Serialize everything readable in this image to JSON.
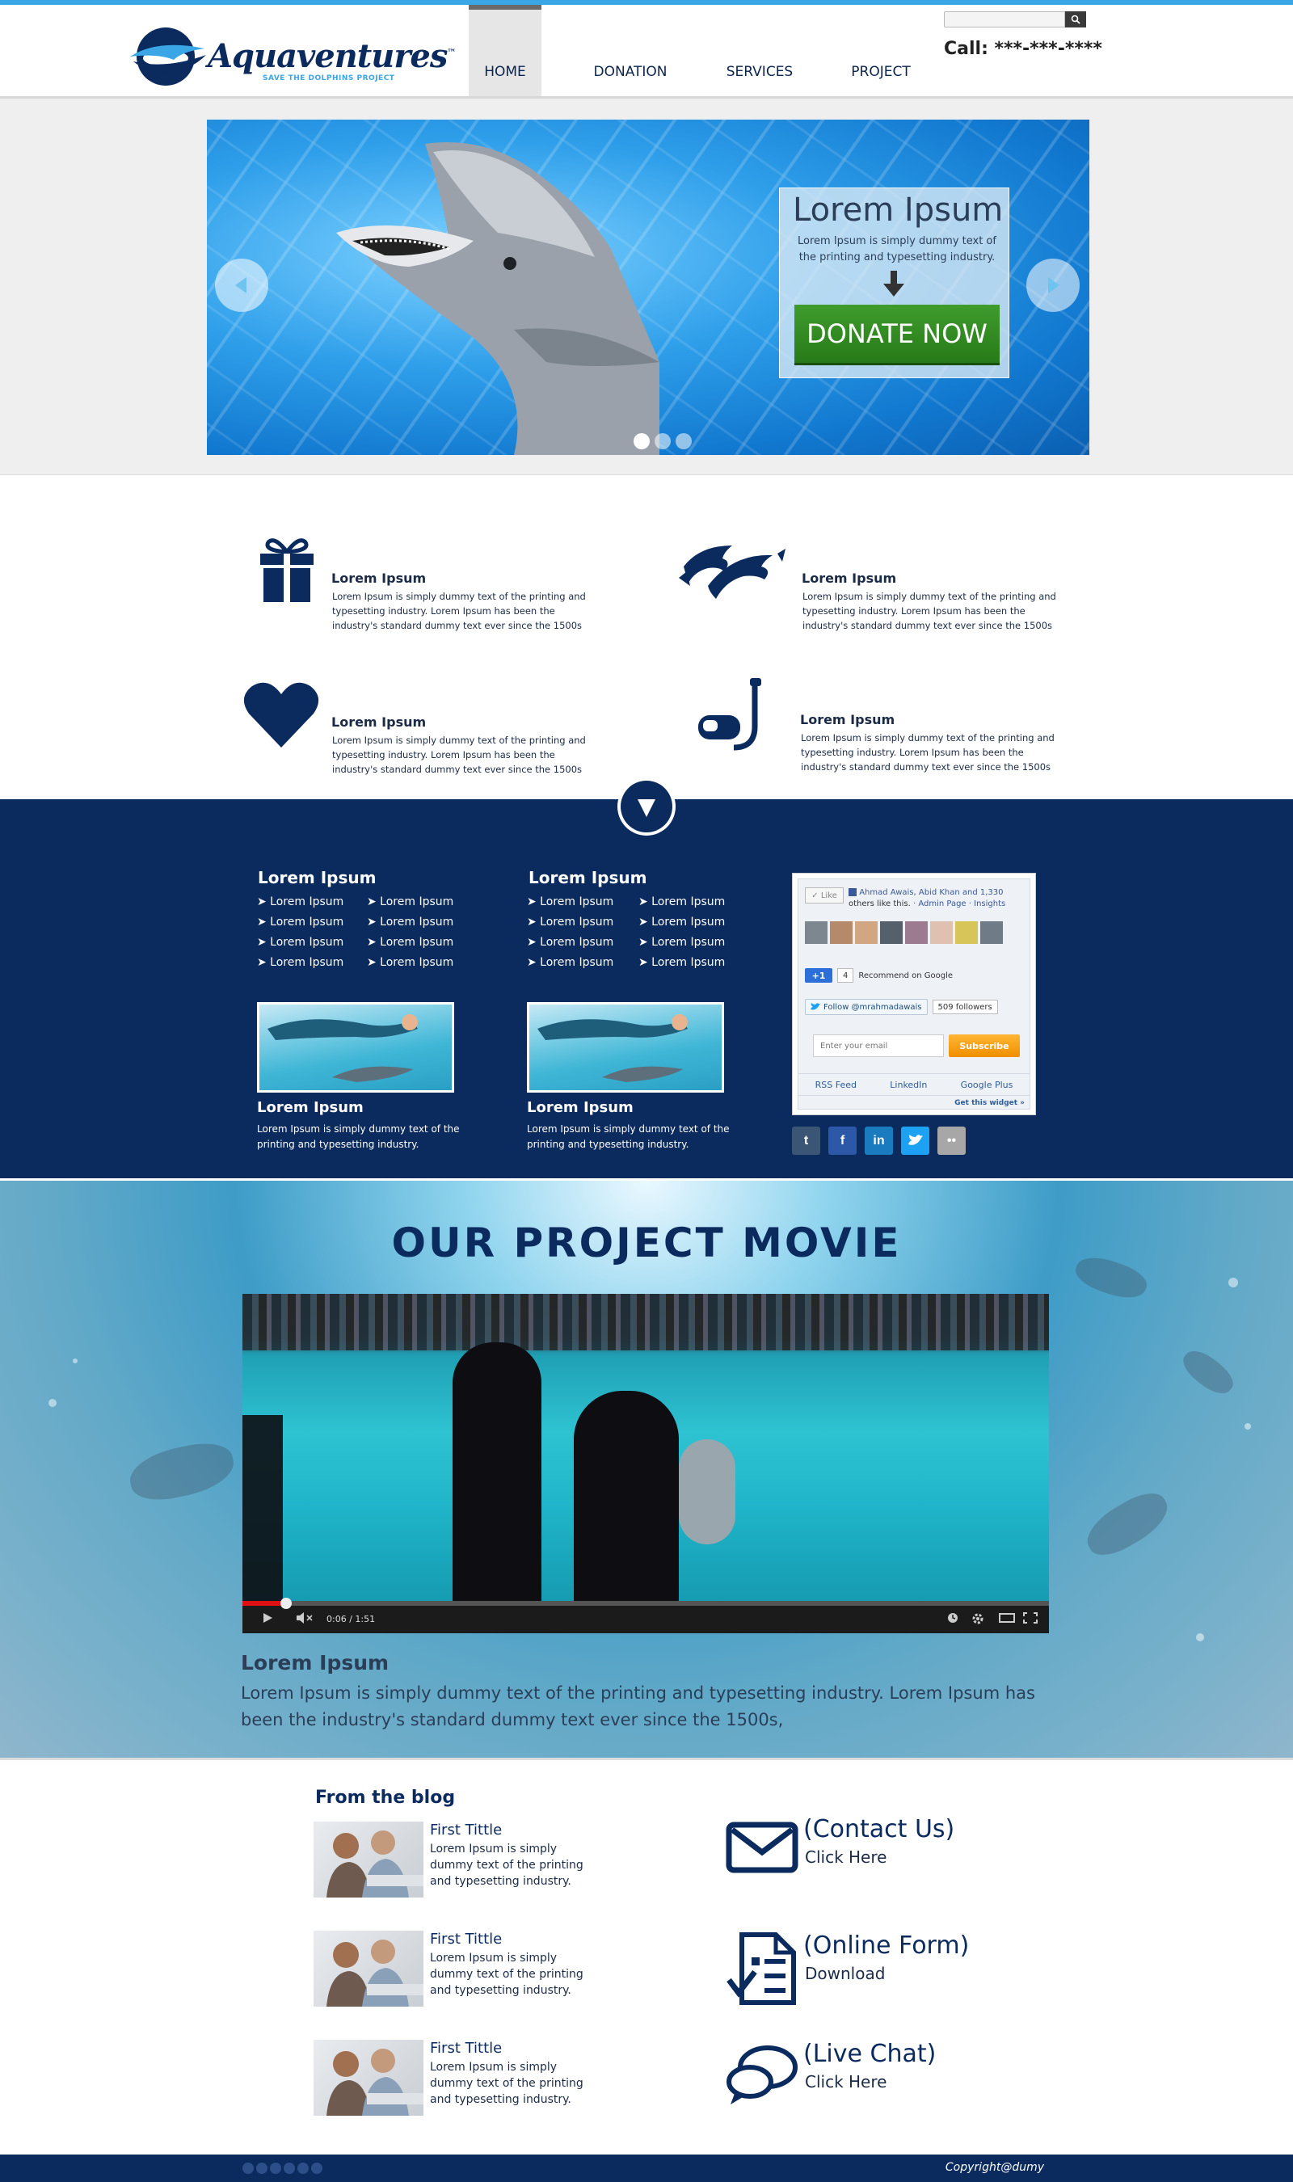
{
  "header": {
    "logo_text": "Aquaventures",
    "logo_tm": "™",
    "logo_sub": "SAVE THE DOLPHINS PROJECT",
    "nav": [
      "HOME",
      "DONATION",
      "SERVICES",
      "PROJECT"
    ],
    "search_placeholder": "",
    "call": "Call: ***-***-****"
  },
  "hero": {
    "title": "Lorem Ipsum",
    "text": "Lorem Ipsum is simply dummy text of the printing and typesetting industry.",
    "donate_label": "DONATE NOW",
    "slides": 3,
    "active_slide": 1
  },
  "features": [
    {
      "title": "Lorem Ipsum",
      "text": "Lorem Ipsum is simply dummy text of the printing and typesetting industry. Lorem Ipsum has been the industry's standard dummy text ever since the 1500s",
      "icon": "gift-icon"
    },
    {
      "title": "Lorem Ipsum",
      "text": "Lorem Ipsum is simply dummy text of the printing and typesetting industry. Lorem Ipsum has been the industry's standard dummy text ever since the 1500s",
      "icon": "dolphins-icon"
    },
    {
      "title": "Lorem Ipsum",
      "text": "Lorem Ipsum is simply dummy text of the printing and typesetting industry. Lorem Ipsum has been the industry's standard dummy text ever since the 1500s",
      "icon": "heart-icon"
    },
    {
      "title": "Lorem Ipsum",
      "text": "Lorem Ipsum is simply dummy text of the printing and typesetting industry. Lorem Ipsum has been the industry's standard dummy text ever since the 1500s",
      "icon": "snorkel-icon"
    }
  ],
  "navy": {
    "columns": [
      {
        "title": "Lorem Ipsum",
        "links_left": [
          "➤ Lorem Ipsum",
          "➤ Lorem Ipsum",
          "➤ Lorem Ipsum",
          "➤ Lorem Ipsum"
        ],
        "links_right": [
          "➤ Lorem Ipsum",
          "➤ Lorem Ipsum",
          "➤ Lorem Ipsum",
          "➤ Lorem Ipsum"
        ],
        "card_title": "Lorem Ipsum",
        "card_text": "Lorem Ipsum is simply dummy text of the printing and typesetting industry."
      },
      {
        "title": "Lorem Ipsum",
        "links_left": [
          "➤ Lorem Ipsum",
          "➤ Lorem Ipsum",
          "➤ Lorem Ipsum",
          "➤ Lorem Ipsum"
        ],
        "links_right": [
          "➤ Lorem Ipsum",
          "➤ Lorem Ipsum",
          "➤ Lorem Ipsum",
          "➤ Lorem Ipsum"
        ],
        "card_title": "Lorem Ipsum",
        "card_text": "Lorem Ipsum is simply dummy text of the printing and typesetting industry."
      }
    ],
    "widget": {
      "like_label": "Like",
      "like_names": "Ahmad Awais, Abid Khan and 1,330",
      "like_rest": "others like this.",
      "admin_page": "· Admin Page",
      "insights": "· Insights",
      "gplus_label": "+1",
      "gplus_count": "4",
      "gplus_text": "Recommend on Google",
      "twitter_label": "Follow @mrahmadawais",
      "twitter_count": "509 followers",
      "email_placeholder": "Enter your email",
      "subscribe_label": "Subscribe",
      "links": [
        "RSS Feed",
        "LinkedIn",
        "Google Plus"
      ],
      "get_widget": "Get this widget »"
    },
    "social": [
      {
        "name": "tumblr",
        "glyph": "t",
        "color": "#3b5574"
      },
      {
        "name": "facebook",
        "glyph": "f",
        "color": "#2d58a8"
      },
      {
        "name": "linkedin",
        "glyph": "in",
        "color": "#1a7bbf"
      },
      {
        "name": "twitter",
        "glyph": "t",
        "color": "#1da1f2"
      },
      {
        "name": "flickr",
        "glyph": "••",
        "color": "#a7a7a7"
      }
    ]
  },
  "movie": {
    "title": "OUR PROJECT MOVIE",
    "time": "0:06 / 1:51",
    "progress": 0.054,
    "subtitle": "Lorem Ipsum",
    "text": "Lorem Ipsum is simply dummy text of the printing and typesetting industry. Lorem Ipsum has been the industry's standard dummy text ever since the 1500s,"
  },
  "blog": {
    "heading": "From the blog",
    "posts": [
      {
        "title": "First Tittle",
        "text": "Lorem Ipsum is simply dummy text of the printing and typesetting industry."
      },
      {
        "title": "First Tittle",
        "text": "Lorem Ipsum is simply dummy text of the printing and typesetting industry."
      },
      {
        "title": "First Tittle",
        "text": "Lorem Ipsum is simply dummy text of the printing and typesetting industry."
      }
    ]
  },
  "contact": [
    {
      "title": "(Contact Us)",
      "sub": "Click Here",
      "icon": "envelope-icon"
    },
    {
      "title": "(Online Form)",
      "sub": "Download",
      "icon": "form-icon"
    },
    {
      "title": "(Live Chat)",
      "sub": "Click Here",
      "icon": "chat-icon"
    }
  ],
  "footer": {
    "copyright": "Copyright@dumy",
    "icons": 6
  },
  "colors": {
    "navy": "#0b2a5e",
    "accent_blue": "#3aa6e6",
    "donate_green": "#3f9c2c"
  }
}
